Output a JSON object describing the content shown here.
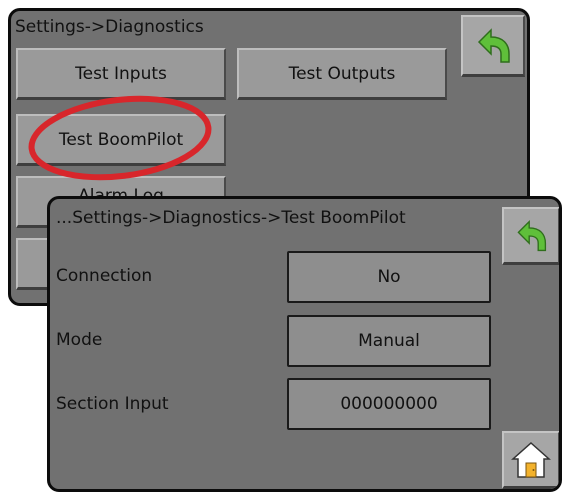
{
  "back_screen": {
    "title": "Settings->Diagnostics",
    "buttons": {
      "test_inputs": "Test Inputs",
      "test_outputs": "Test Outputs",
      "test_boompilot": "Test BoomPilot",
      "partially_hidden": "Alarm Log"
    }
  },
  "front_screen": {
    "title": "...Settings->Diagnostics->Test BoomPilot",
    "rows": [
      {
        "label": "Connection",
        "value": "No"
      },
      {
        "label": "Mode",
        "value": "Manual"
      },
      {
        "label": "Section Input",
        "value": "000000000"
      }
    ]
  },
  "icons": {
    "back": "back-arrow-icon",
    "home": "home-icon"
  },
  "colors": {
    "screen_bg": "#717171",
    "button_bg": "#9a9a9a",
    "arrow_green": "#5fbf3a",
    "highlight_red": "#d8262b"
  }
}
